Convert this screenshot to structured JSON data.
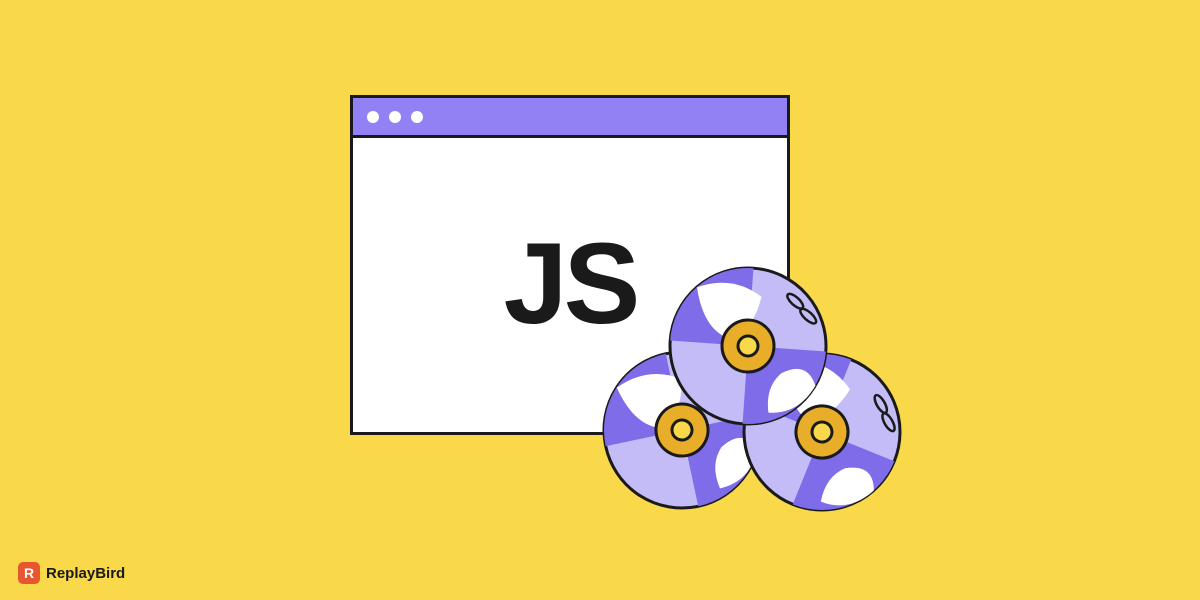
{
  "window": {
    "content_label": "JS"
  },
  "brand": {
    "mark_letter": "R",
    "name": "ReplayBird"
  },
  "colors": {
    "background": "#F9D84A",
    "accent_purple": "#9181F4",
    "accent_purple_light": "#C4BCF7",
    "disc_center": "#E8AE2A",
    "ink": "#1A1A1A",
    "brand_red": "#E8562F"
  }
}
